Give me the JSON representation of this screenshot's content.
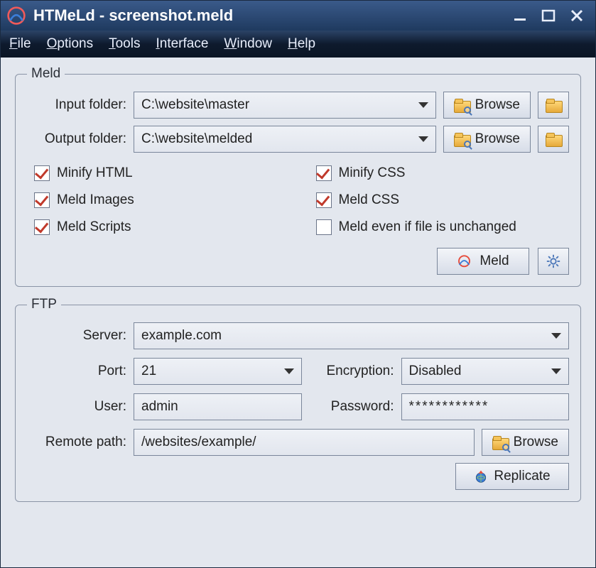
{
  "title": "HTMeLd - screenshot.meld",
  "menu": [
    "File",
    "Options",
    "Tools",
    "Interface",
    "Window",
    "Help"
  ],
  "meld": {
    "legend": "Meld",
    "input_label": "Input folder:",
    "input_value": "C:\\website\\master",
    "output_label": "Output folder:",
    "output_value": "C:\\website\\melded",
    "browse": "Browse",
    "checks": {
      "minify_html": "Minify HTML",
      "minify_css": "Minify CSS",
      "meld_images": "Meld Images",
      "meld_css": "Meld CSS",
      "meld_scripts": "Meld Scripts",
      "meld_unchanged": "Meld even if file is unchanged"
    },
    "meld_button": "Meld"
  },
  "ftp": {
    "legend": "FTP",
    "server_label": "Server:",
    "server_value": "example.com",
    "port_label": "Port:",
    "port_value": "21",
    "encryption_label": "Encryption:",
    "encryption_value": "Disabled",
    "user_label": "User:",
    "user_value": "admin",
    "password_label": "Password:",
    "password_value": "************",
    "remote_label": "Remote path:",
    "remote_value": "/websites/example/",
    "browse": "Browse",
    "replicate": "Replicate"
  }
}
